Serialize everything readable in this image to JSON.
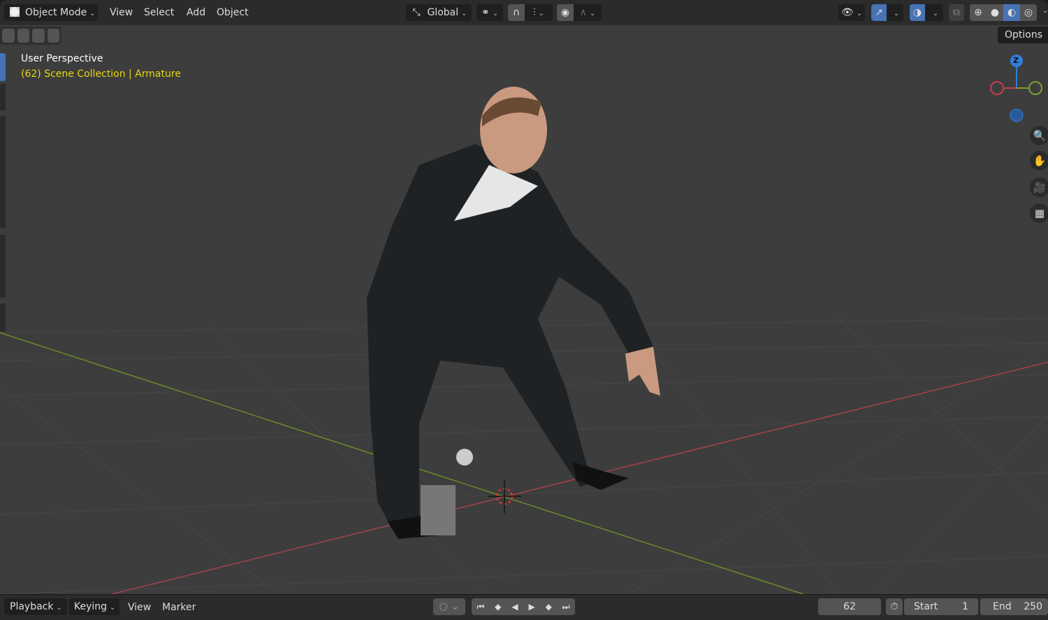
{
  "header": {
    "mode": "Object Mode",
    "menus": [
      "View",
      "Select",
      "Add",
      "Object"
    ],
    "transform_orientation": "Global",
    "options_label": "Options"
  },
  "viewport": {
    "view_name": "User Perspective",
    "collection_info": "(62) Scene Collection",
    "active_object": "Armature",
    "gizmo_axis_label": "Z"
  },
  "timeline": {
    "menus": [
      "Playback",
      "Keying",
      "View",
      "Marker"
    ],
    "current_frame": "62",
    "start_label": "Start",
    "start_value": "1",
    "end_label": "End",
    "end_value": "250"
  },
  "colors": {
    "accent": "#4772b3",
    "info_text": "#e6d80f",
    "x_axis": "#c53e4d",
    "y_axis": "#7ba12d",
    "z_axis": "#2f7fd9"
  }
}
